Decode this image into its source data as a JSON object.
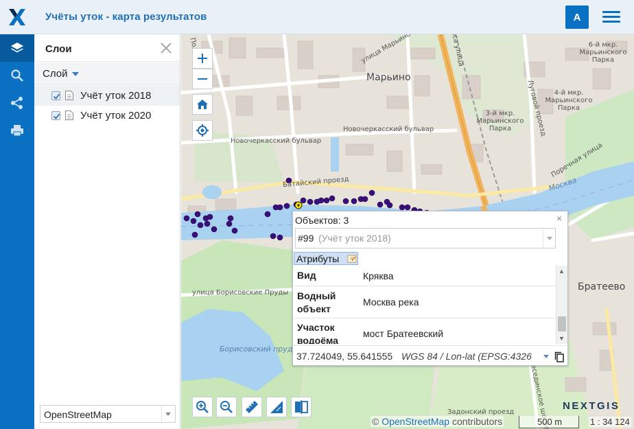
{
  "app": {
    "title": "Учёты уток - карта результатов",
    "avatar_letter": "А"
  },
  "rail": {
    "items": [
      "layers",
      "search",
      "share",
      "print"
    ]
  },
  "panel": {
    "title": "Слои",
    "layer_menu_label": "Слой",
    "layers": [
      {
        "name": "Учёт уток 2018",
        "checked": true
      },
      {
        "name": "Учёт уток 2020",
        "checked": true
      }
    ],
    "basemap": "OpenStreetMap"
  },
  "map": {
    "labels": {
      "marino": "Марьино",
      "bratеevo": "Братеево",
      "moskva": "Москва",
      "novocherk1": "Новочеркасский бульвар",
      "novocherk2": "Новочеркасский бульвар",
      "bataisky": "Батайский проезд",
      "borisovskie": "улица Борисовские Пруды",
      "borisovsky_prud": "Борисовский пруд",
      "porechnaya": "Поречная улица",
      "lugovoy": "Луговой проезд",
      "mkr3": "3-й мкр. Марьинского Парка",
      "mkr4": "4-й мкр. Марьинского Парка",
      "mkr6": "6-й мкр. Марьинского Парка",
      "kasa_ul": "Каса улица",
      "besedinskoe": "Бесединское шоссе",
      "zadonsky": "Задонский проезд",
      "marino_street": "улица Марьино",
      "podolskaya": "Подольская"
    },
    "attribution_prefix": "©",
    "attribution_link": "OpenStreetMap",
    "attribution_suffix": "contributors",
    "scale_text": "500 m",
    "scale_ratio": "1 : 34 124",
    "logo_text": "NEXTGIS"
  },
  "popup": {
    "count_label": "Объектов: 3",
    "close_label": "×",
    "feature_id": "#99",
    "feature_layer": "(Учёт уток 2018)",
    "tab_label": "Атрибуты",
    "attributes": [
      {
        "key": "Вид",
        "value": "Кряква"
      },
      {
        "key": "Водный объект",
        "value": "Москва река"
      },
      {
        "key": "Участок водоёма",
        "value": "мост Братеевский"
      }
    ],
    "coord_value": "37.724049, 55.641555",
    "coord_crs": "WGS 84 / Lon-lat (EPSG:4326"
  }
}
